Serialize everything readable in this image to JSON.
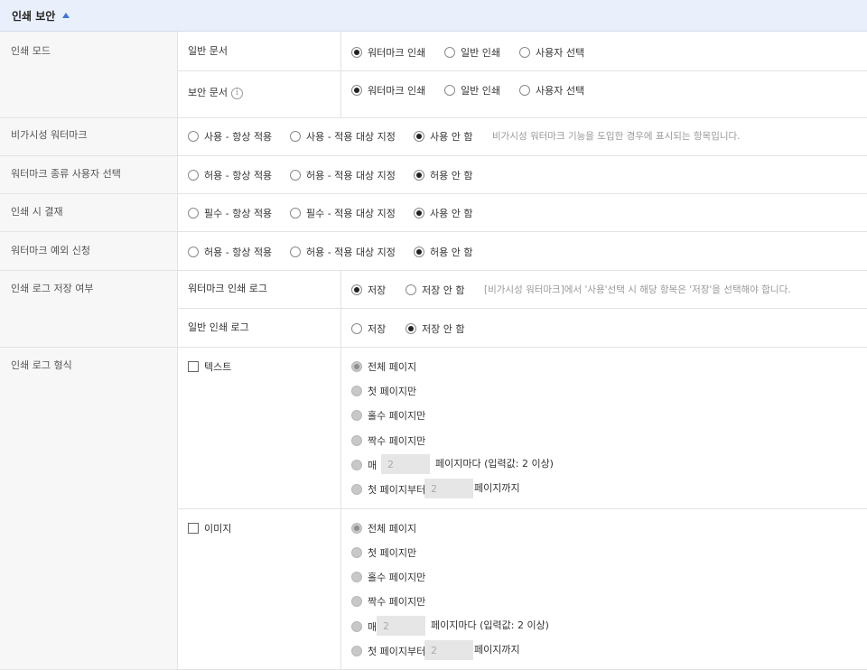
{
  "section": {
    "title": "인쇄 보안"
  },
  "print_mode": {
    "label": "인쇄 모드",
    "normal": {
      "label": "일반 문서",
      "options": [
        "워터마크 인쇄",
        "일반 인쇄",
        "사용자 선택"
      ],
      "selected": "워터마크 인쇄"
    },
    "secure": {
      "label": "보안 문서",
      "options": [
        "워터마크 인쇄",
        "일반 인쇄",
        "사용자 선택"
      ],
      "selected": "워터마크 인쇄"
    }
  },
  "invisible_watermark": {
    "label": "비가시성 워터마크",
    "options": [
      "사용 - 항상 적용",
      "사용 - 적용 대상 지정",
      "사용 안 함"
    ],
    "selected": "사용 안 함",
    "desc": "비가시성 워터마크 기능을 도입한 경우에 표시되는 항목입니다."
  },
  "watermark_type": {
    "label": "워터마크 종류 사용자 선택",
    "options": [
      "허용 - 항상 적용",
      "허용 - 적용 대상 지정",
      "허용 안 함"
    ],
    "selected": "허용 안 함"
  },
  "print_approval": {
    "label": "인쇄 시 결재",
    "options": [
      "필수 - 항상 적용",
      "필수 - 적용 대상 지정",
      "사용 안 함"
    ],
    "selected": "사용 안 함"
  },
  "watermark_exception": {
    "label": "워터마크 예외 신청",
    "options": [
      "허용 - 항상 적용",
      "허용 - 적용 대상 지정",
      "허용 안 함"
    ],
    "selected": "허용 안 함"
  },
  "print_log": {
    "label": "인쇄 로그 저장 여부",
    "watermark_log": {
      "label": "워터마크 인쇄 로그",
      "options": [
        "저장",
        "저장 안 함"
      ],
      "selected": "저장",
      "desc": "[비가시성 워터마크]에서 '사용'선택 시 해당 항목은 '저장'을 선택해야 합니다."
    },
    "normal_log": {
      "label": "일반 인쇄 로그",
      "options": [
        "저장",
        "저장 안 함"
      ],
      "selected": "저장 안 함"
    }
  },
  "log_format": {
    "label": "인쇄 로그 형식",
    "text": {
      "label": "텍스트",
      "options": [
        "전체 페이지",
        "첫 페이지만",
        "홀수 페이지만",
        "짝수 페이지만"
      ],
      "every_prefix": "매",
      "every_value": "2",
      "every_suffix": "페이지마다 (입력값: 2 이상)",
      "from_first_prefix": "첫 페이지부터",
      "from_first_value": "2",
      "from_first_suffix": "페이지까지"
    },
    "image": {
      "label": "이미지",
      "options": [
        "전체 페이지",
        "첫 페이지만",
        "홀수 페이지만",
        "짝수 페이지만"
      ],
      "every_prefix": "매",
      "every_value": "2",
      "every_suffix": "페이지마다 (입력값: 2 이상)",
      "from_first_prefix": "첫 페이지부터",
      "from_first_value": "2",
      "from_first_suffix": "페이지까지"
    }
  }
}
